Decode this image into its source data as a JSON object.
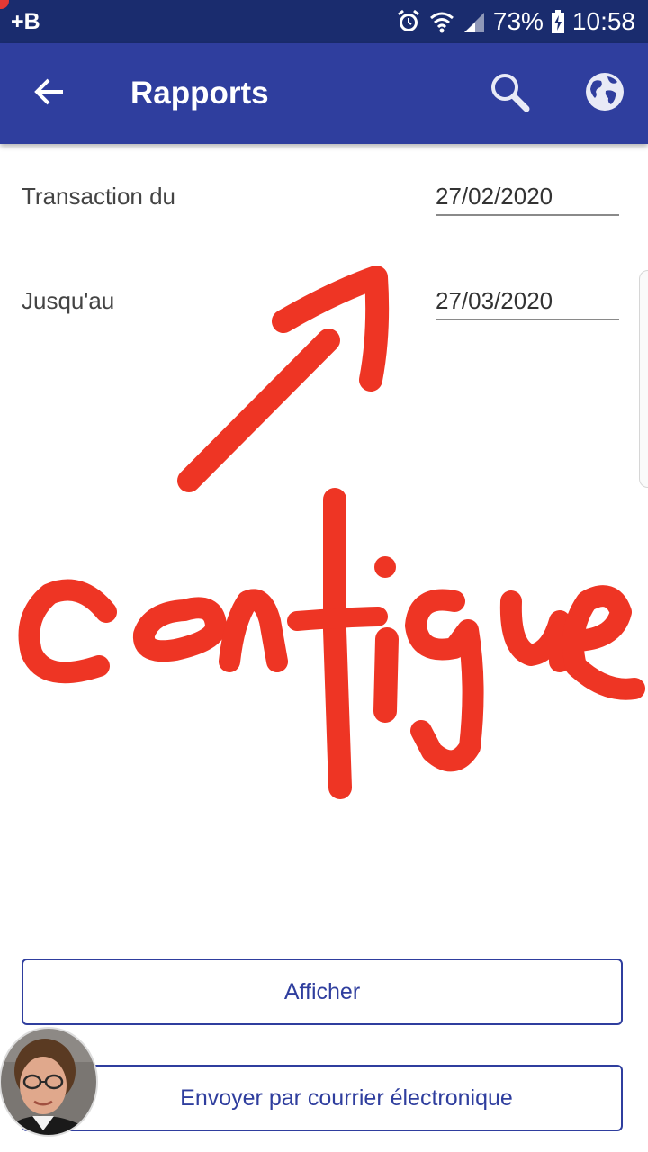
{
  "status_bar": {
    "left_text": "+B",
    "battery_percent": "73%",
    "time": "10:58",
    "icons": [
      "alarm-icon",
      "wifi-icon",
      "signal-icon",
      "battery-charging-icon"
    ]
  },
  "app_bar": {
    "title": "Rapports",
    "back_icon": "arrow-back-icon",
    "search_icon": "search-icon",
    "globe_icon": "globe-icon",
    "color": "#2f3e9e"
  },
  "form": {
    "from_label": "Transaction du",
    "from_value": "27/02/2020",
    "to_label": "Jusqu'au",
    "to_value": "27/03/2020"
  },
  "annotation": {
    "text": "configue",
    "color": "#ee3524",
    "shape": "arrow-pointing-up-right"
  },
  "buttons": {
    "show_label": "Afficher",
    "email_label": "Envoyer par courrier électronique"
  },
  "avatar": {
    "icon": "user-avatar-photo"
  }
}
